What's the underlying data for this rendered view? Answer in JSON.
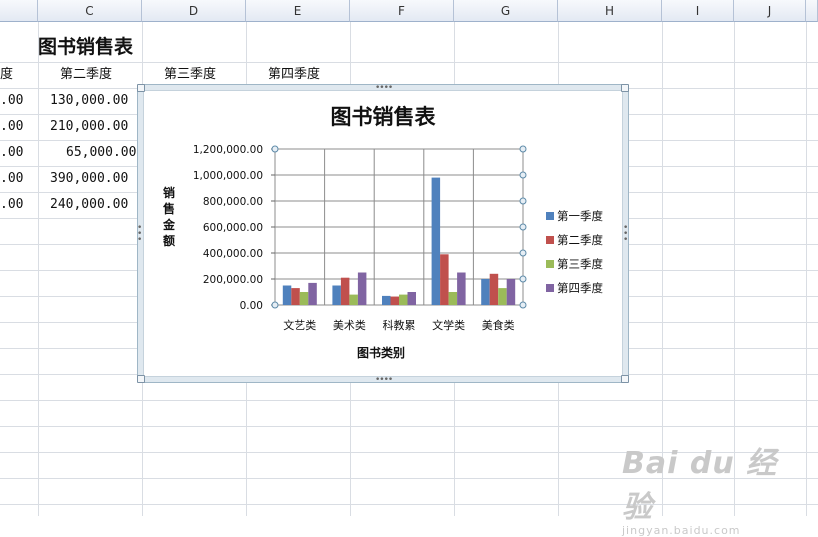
{
  "sheet": {
    "title": "图书销售表",
    "columns": [
      "C",
      "D",
      "E",
      "F",
      "G",
      "H",
      "I",
      "J"
    ],
    "headers": [
      "度",
      "第二季度",
      "第三季度",
      "第四季度"
    ],
    "col_b_cells": [
      ".00",
      ".00",
      ".00",
      ".00",
      ".00"
    ],
    "col_c_values": [
      "130,000.00",
      "210,000.00",
      "65,000.00",
      "390,000.00",
      "240,000.00"
    ]
  },
  "chart_data": {
    "type": "bar",
    "title": "图书销售表",
    "xlabel": "图书类别",
    "ylabel": "销售金额",
    "categories": [
      "文艺类",
      "美术类",
      "科教累",
      "文学类",
      "美食类"
    ],
    "series": [
      {
        "name": "第一季度",
        "color": "#4f81bd",
        "values": [
          150000,
          150000,
          70000,
          980000,
          200000
        ]
      },
      {
        "name": "第二季度",
        "color": "#c0504d",
        "values": [
          130000,
          210000,
          65000,
          390000,
          240000
        ]
      },
      {
        "name": "第三季度",
        "color": "#9bbb59",
        "values": [
          100000,
          80000,
          80000,
          100000,
          130000
        ]
      },
      {
        "name": "第四季度",
        "color": "#8064a2",
        "values": [
          170000,
          250000,
          100000,
          250000,
          200000
        ]
      }
    ],
    "ylim": [
      0,
      1200000
    ],
    "yticks": [
      0,
      200000,
      400000,
      600000,
      800000,
      1000000,
      1200000
    ],
    "ytick_labels": [
      "0.00",
      "200,000.00",
      "400,000.00",
      "600,000.00",
      "800,000.00",
      "1,000,000.00",
      "1,200,000.00"
    ],
    "grid": true,
    "legend": "right"
  },
  "watermark": {
    "logo": "Bai du 经验",
    "url": "jingyan.baidu.com"
  }
}
